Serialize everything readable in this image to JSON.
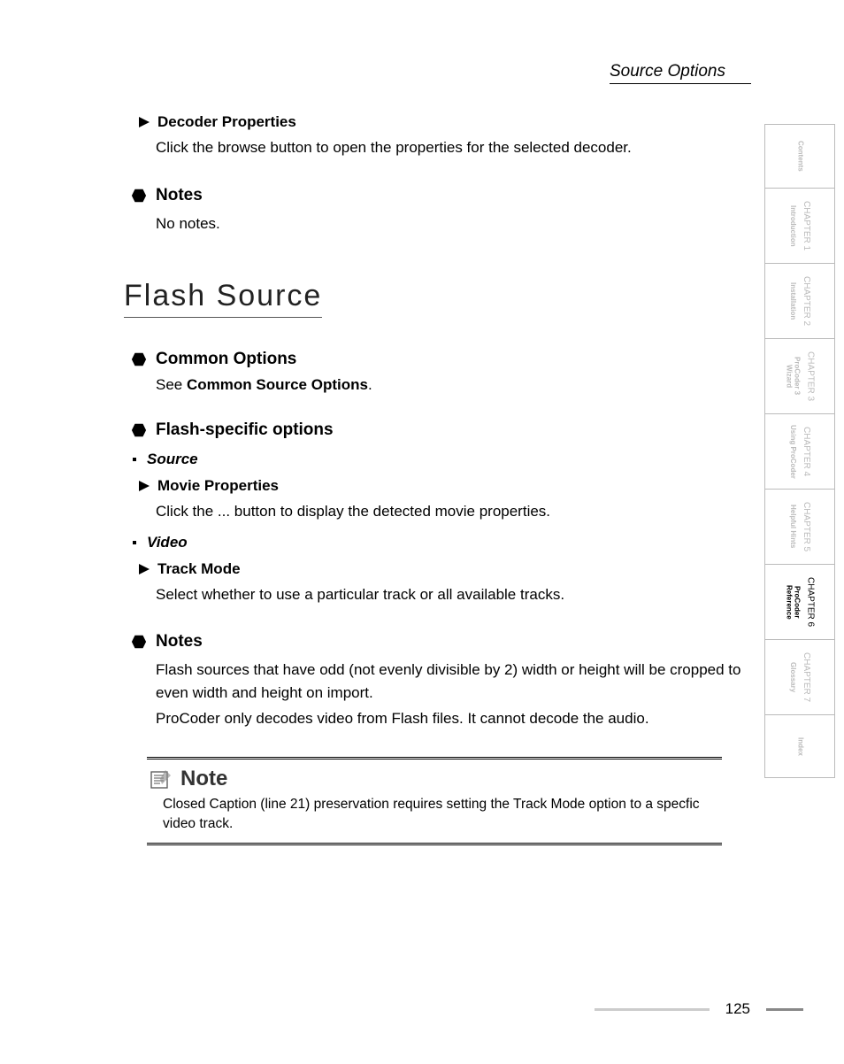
{
  "running_header": "Source Options",
  "sec1": {
    "decoder_properties": {
      "title": "Decoder Properties",
      "body": "Click the browse button to open the properties for the selected decoder."
    },
    "notes": {
      "title": "Notes",
      "body": "No notes."
    }
  },
  "flash": {
    "title": "Flash Source",
    "common": {
      "title": "Common Options",
      "see_prefix": "See ",
      "see_bold": "Common Source Options",
      "see_suffix": "."
    },
    "specific": {
      "title": "Flash-specific options",
      "source_label": "Source",
      "movie_props": {
        "title": "Movie Properties",
        "body": "Click the ... button to display the detected movie properties."
      },
      "video_label": "Video",
      "track_mode": {
        "title": "Track Mode",
        "body": "Select whether to use a particular track or all available tracks."
      }
    },
    "notes2": {
      "title": "Notes",
      "body1": "Flash sources that have odd (not evenly divisible by 2) width or height will be cropped to even width and height on import.",
      "body2": "ProCoder only decodes video from Flash files. It cannot decode the audio."
    },
    "note_box": {
      "heading": "Note",
      "body": "Closed Caption (line 21) preservation requires setting the Track Mode option to a specfic video track."
    }
  },
  "tabs": {
    "contents": "Contents",
    "ch1": {
      "chapter": "CHAPTER 1",
      "sub": "Introduction"
    },
    "ch2": {
      "chapter": "CHAPTER 2",
      "sub": "Installation"
    },
    "ch3": {
      "chapter": "CHAPTER 3",
      "sub": "ProCoder 3\nWizard"
    },
    "ch4": {
      "chapter": "CHAPTER 4",
      "sub": "Using ProCoder"
    },
    "ch5": {
      "chapter": "CHAPTER 5",
      "sub": "Helpful Hints"
    },
    "ch6": {
      "chapter": "CHAPTER 6",
      "sub": "ProCoder\nReference"
    },
    "ch7": {
      "chapter": "CHAPTER 7",
      "sub": "Glossary"
    },
    "index": "Index"
  },
  "page_number": "125"
}
